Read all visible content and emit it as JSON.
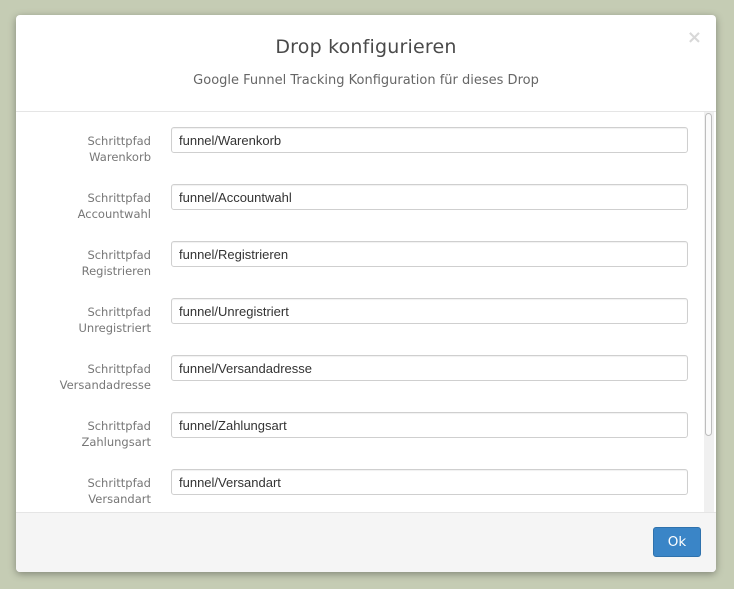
{
  "modal": {
    "title": "Drop konfigurieren",
    "subtitle": "Google Funnel Tracking Konfiguration für dieses Drop",
    "close_label": "×"
  },
  "fields": [
    {
      "label_line1": "Schrittpfad",
      "label_line2": "Warenkorb",
      "value": "funnel/Warenkorb"
    },
    {
      "label_line1": "Schrittpfad",
      "label_line2": "Accountwahl",
      "value": "funnel/Accountwahl"
    },
    {
      "label_line1": "Schrittpfad",
      "label_line2": "Registrieren",
      "value": "funnel/Registrieren"
    },
    {
      "label_line1": "Schrittpfad",
      "label_line2": "Unregistriert",
      "value": "funnel/Unregistriert"
    },
    {
      "label_line1": "Schrittpfad",
      "label_line2": "Versandadresse",
      "value": "funnel/Versandadresse"
    },
    {
      "label_line1": "Schrittpfad",
      "label_line2": "Zahlungsart",
      "value": "funnel/Zahlungsart"
    },
    {
      "label_line1": "Schrittpfad",
      "label_line2": "Versandart",
      "value": "funnel/Versandart"
    }
  ],
  "footer": {
    "ok_label": "Ok"
  },
  "colors": {
    "backdrop": "#c5ccb4",
    "primary_button": "#3a85c7"
  }
}
